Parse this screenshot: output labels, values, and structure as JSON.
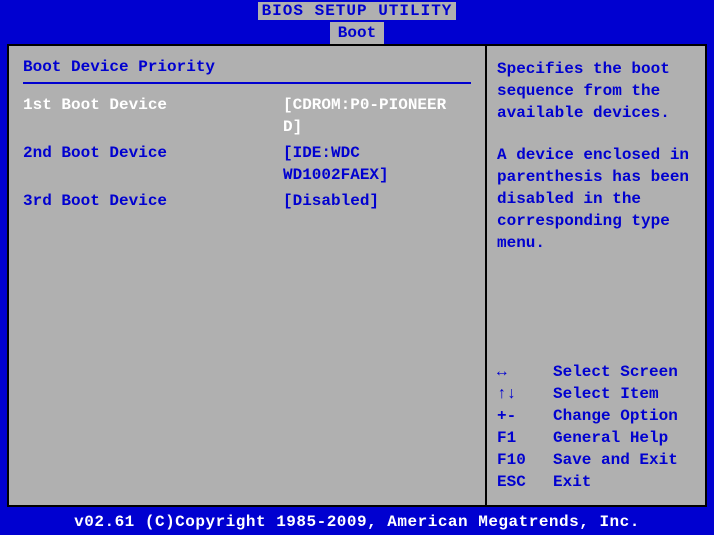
{
  "title": "BIOS SETUP UTILITY",
  "activeTab": "Boot",
  "leftPanel": {
    "sectionTitle": "Boot Device Priority",
    "items": [
      {
        "label": "1st Boot Device",
        "value": "[CDROM:P0-PIONEER D]",
        "selected": true
      },
      {
        "label": "2nd Boot Device",
        "value": "[IDE:WDC WD1002FAEX]",
        "selected": false
      },
      {
        "label": "3rd Boot Device",
        "value": "[Disabled]",
        "selected": false
      }
    ]
  },
  "rightPanel": {
    "help1": "Specifies the boot sequence from the available devices.",
    "help2": "A device enclosed in parenthesis has been disabled in the corresponding type menu.",
    "nav": [
      {
        "key": "↔",
        "action": "Select Screen"
      },
      {
        "key": "↑↓",
        "action": "Select Item"
      },
      {
        "key": "+-",
        "action": "Change Option"
      },
      {
        "key": "F1",
        "action": "General Help"
      },
      {
        "key": "F10",
        "action": "Save and Exit"
      },
      {
        "key": "ESC",
        "action": "Exit"
      }
    ]
  },
  "footer": "v02.61 (C)Copyright 1985-2009, American Megatrends, Inc."
}
